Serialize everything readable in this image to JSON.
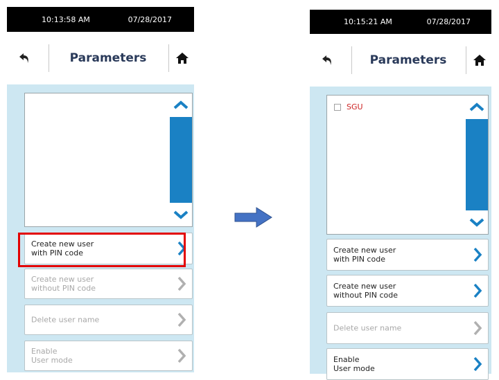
{
  "screens": [
    {
      "status": {
        "time": "10:13:58 AM",
        "date": "07/28/2017"
      },
      "header": {
        "title": "Parameters"
      },
      "list": {
        "items": []
      },
      "buttons": [
        {
          "label": "Create new user\nwith PIN code",
          "state": "enabled",
          "highlighted": true
        },
        {
          "label": "Create new user\nwithout PIN code",
          "state": "disabled"
        },
        {
          "label": "Delete user name",
          "state": "disabled"
        },
        {
          "label": "Enable\nUser mode",
          "state": "disabled"
        }
      ]
    },
    {
      "status": {
        "time": "10:15:21 AM",
        "date": "07/28/2017"
      },
      "header": {
        "title": "Parameters"
      },
      "list": {
        "items": [
          {
            "label": "SGU",
            "checked": false
          }
        ]
      },
      "buttons": [
        {
          "label": "Create new user\nwith PIN code",
          "state": "enabled"
        },
        {
          "label": "Create new user\nwithout PIN code",
          "state": "enabled"
        },
        {
          "label": "Delete user name",
          "state": "disabled"
        },
        {
          "label": "Enable\nUser mode",
          "state": "enabled"
        }
      ]
    }
  ],
  "colors": {
    "accent": "#1a81c4",
    "panel_bg": "#cde7f2",
    "highlight": "#e30000",
    "list_item_text": "#cc2222",
    "disabled_text": "#a8a8a8",
    "flow_arrow": "#4472c4"
  },
  "icons": {
    "back": "back-arrow-icon",
    "home": "home-icon",
    "scroll_up": "chevron-up-icon",
    "scroll_down": "chevron-down-icon",
    "button_chevron": "chevron-right-icon",
    "flow": "right-arrow-icon"
  }
}
